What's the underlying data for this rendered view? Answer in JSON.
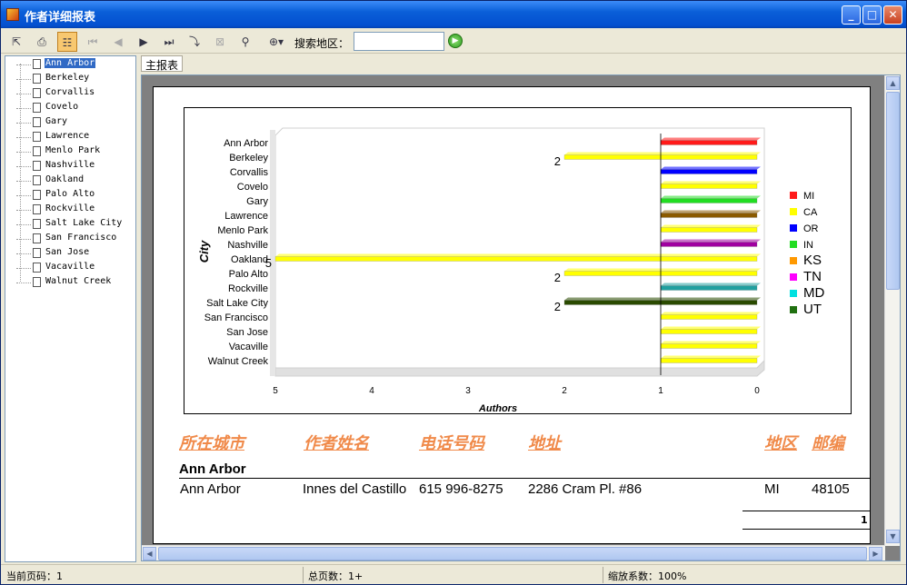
{
  "window": {
    "title": "作者详细报表"
  },
  "toolbar": {
    "search_label": "搜索地区：",
    "search_value": "",
    "search_placeholder": ""
  },
  "tree": {
    "items": [
      "Ann Arbor",
      "Berkeley",
      "Corvallis",
      "Covelo",
      "Gary",
      "Lawrence",
      "Menlo Park",
      "Nashville",
      "Oakland",
      "Palo Alto",
      "Rockville",
      "Salt Lake City",
      "San Francisco",
      "San Jose",
      "Vacaville",
      "Walnut Creek"
    ],
    "selected_index": 0
  },
  "tabs": {
    "main": "主报表"
  },
  "chart_data": {
    "type": "bar",
    "orientation": "horizontal",
    "stacked": true,
    "ylabel": "City",
    "xlabel": "Authors",
    "categories": [
      "Ann Arbor",
      "Berkeley",
      "Corvallis",
      "Covelo",
      "Gary",
      "Lawrence",
      "Menlo Park",
      "Nashville",
      "Oakland",
      "Palo Alto",
      "Rockville",
      "Salt Lake City",
      "San Francisco",
      "San Jose",
      "Vacaville",
      "Walnut Creek"
    ],
    "x_ticks": [
      "5",
      "4",
      "3",
      "2",
      "1",
      "0"
    ],
    "xlim": [
      0,
      5
    ],
    "x_reversed": true,
    "legend_position": "right",
    "series": [
      {
        "name": "MI",
        "color": "#ff1a1a",
        "values": [
          1,
          0,
          0,
          0,
          0,
          0,
          0,
          0,
          0,
          0,
          0,
          0,
          0,
          0,
          0,
          0
        ]
      },
      {
        "name": "CA",
        "color": "#ffff00",
        "values": [
          0,
          2,
          0,
          1,
          0,
          0,
          1,
          0,
          5,
          2,
          0,
          0,
          1,
          1,
          1,
          1
        ]
      },
      {
        "name": "OR",
        "color": "#0000ff",
        "values": [
          0,
          0,
          1,
          0,
          0,
          0,
          0,
          0,
          0,
          0,
          0,
          0,
          0,
          0,
          0,
          0
        ]
      },
      {
        "name": "IN",
        "color": "#22dd22",
        "values": [
          0,
          0,
          0,
          0,
          1,
          0,
          0,
          0,
          0,
          0,
          0,
          0,
          0,
          0,
          0,
          0
        ]
      },
      {
        "name": "KS",
        "color": "#8b5a00",
        "values": [
          0,
          0,
          0,
          0,
          0,
          1,
          0,
          0,
          0,
          0,
          0,
          0,
          0,
          0,
          0,
          0
        ]
      },
      {
        "name": "TN",
        "color": "#a000a0",
        "values": [
          0,
          0,
          0,
          0,
          0,
          0,
          0,
          1,
          0,
          0,
          0,
          0,
          0,
          0,
          0,
          0
        ]
      },
      {
        "name": "MD",
        "color": "#20a0a0",
        "values": [
          0,
          0,
          0,
          0,
          0,
          0,
          0,
          0,
          0,
          0,
          1,
          0,
          0,
          0,
          0,
          0
        ]
      },
      {
        "name": "UT",
        "color": "#2a4a00",
        "values": [
          0,
          0,
          0,
          0,
          0,
          0,
          0,
          0,
          0,
          0,
          0,
          2,
          0,
          0,
          0,
          0
        ]
      }
    ],
    "legend_swatch_colors": [
      "#ff1a1a",
      "#ffff00",
      "#0000ff",
      "#22dd22",
      "#ff9900",
      "#ff00ff",
      "#00e0e0",
      "#207010"
    ],
    "data_labels": [
      {
        "category": "Berkeley",
        "text": "2"
      },
      {
        "category": "Oakland",
        "text": "5"
      },
      {
        "category": "Palo Alto",
        "text": "2"
      },
      {
        "category": "Salt Lake City",
        "text": "2"
      }
    ]
  },
  "report": {
    "headers": {
      "city": "所在城市",
      "name": "作者姓名",
      "phone": "电话号码",
      "address": "地址",
      "state": "地区",
      "zip": "邮编"
    },
    "group_title": "Ann Arbor",
    "row": {
      "city": "Ann Arbor",
      "name": "Innes del Castillo",
      "phone": "615 996-8275",
      "address": "2286 Cram Pl. #86",
      "state": "MI",
      "zip": "48105"
    },
    "group_count": "1"
  },
  "status": {
    "current_page": "当前页码：1",
    "total_pages": "总页数：1+",
    "zoom": "缩放系数：100%"
  }
}
